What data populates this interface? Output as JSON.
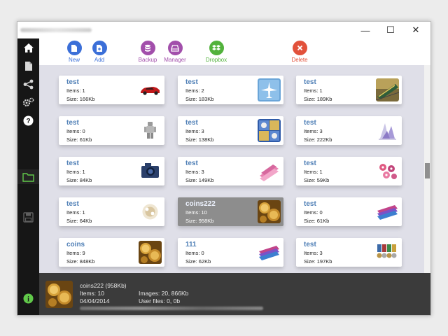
{
  "window": {
    "controls": {
      "minimize": "—",
      "maximize": "☐",
      "close": "✕"
    }
  },
  "sidebar": {
    "items": [
      {
        "name": "home-icon",
        "active": false
      },
      {
        "name": "file-icon",
        "active": false
      },
      {
        "name": "share-icon",
        "active": false
      },
      {
        "name": "settings-gears-icon",
        "active": false
      },
      {
        "name": "help-icon",
        "active": false
      },
      {
        "name": "folder-icon",
        "active": true
      },
      {
        "name": "save-disk-icon",
        "active": false
      },
      {
        "name": "info-icon",
        "active": false
      }
    ]
  },
  "toolbar": {
    "new_label": "New",
    "add_label": "Add",
    "backup_label": "Backup",
    "manager_label": "Manager",
    "dropbox_label": "Dropbox",
    "delete_label": "Delete",
    "colors": {
      "new": "#3b6fd8",
      "add": "#3b6fd8",
      "backup": "#a24fab",
      "manager": "#a24fab",
      "dropbox": "#52b23c",
      "delete": "#e2513b"
    }
  },
  "collections": [
    {
      "title": "test",
      "items": "Items: 1",
      "size": "Size: 166Kb",
      "thumb": "red-car"
    },
    {
      "title": "test",
      "items": "Items: 2",
      "size": "Size: 183Kb",
      "thumb": "blue-plane"
    },
    {
      "title": "test",
      "items": "Items: 1",
      "size": "Size: 189Kb",
      "thumb": "train"
    },
    {
      "title": "test",
      "items": "Items: 0",
      "size": "Size: 61Kb",
      "thumb": "robot-figure"
    },
    {
      "title": "test",
      "items": "Items: 3",
      "size": "Size: 138Kb",
      "thumb": "stamps"
    },
    {
      "title": "test",
      "items": "Items: 3",
      "size": "Size: 222Kb",
      "thumb": "crystals"
    },
    {
      "title": "test",
      "items": "Items: 1",
      "size": "Size: 84Kb",
      "thumb": "camera"
    },
    {
      "title": "test",
      "items": "Items: 3",
      "size": "Size: 149Kb",
      "thumb": "pink-books"
    },
    {
      "title": "test",
      "items": "Items: 1",
      "size": "Size: 59Kb",
      "thumb": "pink-flowers"
    },
    {
      "title": "test",
      "items": "Items: 1",
      "size": "Size: 64Kb",
      "thumb": "pearls"
    },
    {
      "title": "coins222",
      "items": "Items: 10",
      "size": "Size: 958Kb",
      "thumb": "gold-coins",
      "selected": true
    },
    {
      "title": "test",
      "items": "Items: 0",
      "size": "Size: 61Kb",
      "thumb": "banknotes"
    },
    {
      "title": "coins",
      "items": "Items: 9",
      "size": "Size: 848Kb",
      "thumb": "gold-coins"
    },
    {
      "title": "111",
      "items": "Items: 0",
      "size": "Size: 62Kb",
      "thumb": "banknotes"
    },
    {
      "title": "test",
      "items": "Items: 3",
      "size": "Size: 197Kb",
      "thumb": "medals"
    }
  ],
  "status": {
    "title": "coins222 (958Kb)",
    "items": "Items: 10",
    "date": "04/04/2014",
    "images": "Images: 20,  866Kb",
    "user_files": "User files: 0,  0b"
  }
}
